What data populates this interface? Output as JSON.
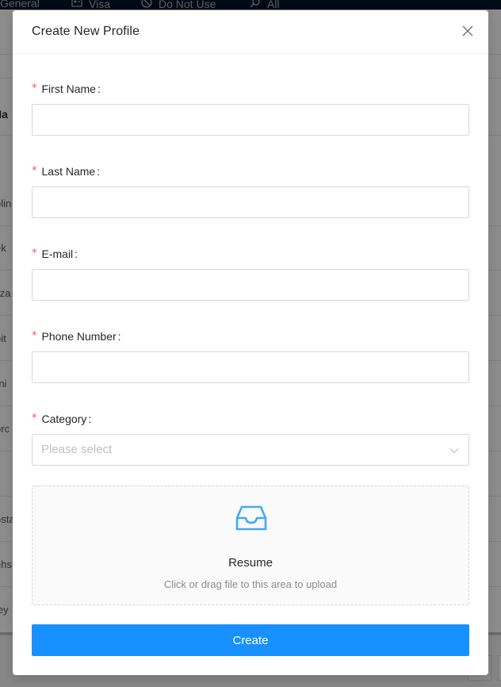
{
  "background": {
    "tabs": [
      {
        "label": "General",
        "icon": "none"
      },
      {
        "label": "Visa",
        "icon": "id-card-icon"
      },
      {
        "label": "Do Not Use",
        "icon": "stop-icon"
      },
      {
        "label": "All",
        "icon": "search-icon"
      }
    ],
    "header_cell": "Na",
    "row_fragments": [
      "olin",
      "ek",
      "ilza",
      "oit",
      "rni",
      "orc",
      "osta",
      "ehs",
      "ley"
    ]
  },
  "modal": {
    "title": "Create New Profile",
    "fields": [
      {
        "label": "First Name",
        "required": true,
        "value": ""
      },
      {
        "label": "Last Name",
        "required": true,
        "value": ""
      },
      {
        "label": "E-mail",
        "required": true,
        "value": ""
      },
      {
        "label": "Phone Number",
        "required": true,
        "value": ""
      }
    ],
    "category": {
      "label": "Category",
      "required": true,
      "placeholder": "Please select"
    },
    "colon": ":",
    "required_mark": "*",
    "upload": {
      "title": "Resume",
      "hint": "Click or drag file to this area to upload",
      "icon": "inbox-icon"
    },
    "submit_label": "Create",
    "colors": {
      "primary": "#1890ff",
      "required": "#ff4d4f",
      "border": "#d9d9d9"
    }
  }
}
